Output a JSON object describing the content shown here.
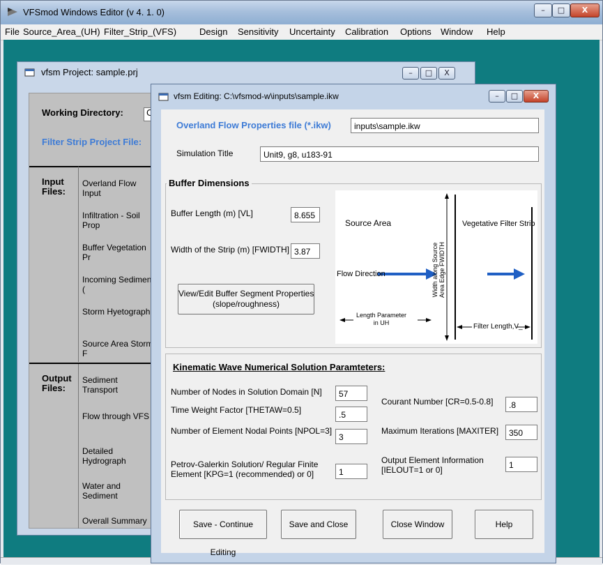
{
  "app": {
    "title": "VFSmod Windows Editor (v 4. 1. 0)",
    "window_controls": {
      "minimize": "–",
      "maximize": "□",
      "close": "X"
    }
  },
  "menu": [
    "File",
    "Source_Area_(UH)",
    "Filter_Strip_(VFS)",
    "Design",
    "Sensitivity",
    "Uncertainty",
    "Calibration",
    "Options",
    "Window",
    "Help"
  ],
  "project_window": {
    "title": "vfsm Project: sample.prj",
    "working_directory_label": "Working Directory:",
    "working_directory_value": "C",
    "filter_strip_label": "Filter Strip Project File:",
    "input_files_label": "Input\nFiles:",
    "input_items": [
      "Overland Flow Input",
      "Infiltration - Soil Prop",
      "Buffer Vegetation Pr",
      "Incoming Sediment (",
      "Storm Hyetograph",
      "Source Area Storm F"
    ],
    "output_files_label": "Output\nFiles:",
    "output_items": [
      "Sediment Transport",
      "Flow through VFS",
      "Detailed Hydrograph",
      "Water and Sediment",
      "Overall Summary"
    ]
  },
  "edit_window": {
    "title": "vfsm Editing: C:\\vfsmod-w\\inputs\\sample.ikw",
    "overland_label": "Overland Flow Properties file (*.ikw)",
    "overland_value": "inputs\\sample.ikw",
    "sim_title_label": "Simulation Title",
    "sim_title_value": "Unit9, g8, u183-91",
    "buffer_frame_title": "Buffer Dimensions",
    "buffer_length_label": "Buffer Length (m) [VL]",
    "buffer_length_value": "8.655",
    "width_label": "Width of the Strip (m) [FWIDTH]",
    "width_value": "3.87",
    "segment_button": "View/Edit Buffer Segment Properties\n(slope/roughness)",
    "diagram": {
      "source_area": "Source Area",
      "vfs": "Vegetative Filter Strip",
      "flow_direction": "Flow Direction",
      "length_param": "Length Parameter\nin UH",
      "width_along": "Width along Source\nArea Edge FWIDTH",
      "filter_length": "Filter Length,V_"
    },
    "kw_frame_title": "Kinematic Wave Numerical Solution Paramteters:",
    "params": {
      "nodes_label": "Number of Nodes in Solution Domain [N]",
      "nodes_value": "57",
      "theta_label": "Time Weight Factor [THETAW=0.5]",
      "theta_value": ".5",
      "npol_label": "Number of Element Nodal Points [NPOL=3]",
      "npol_value": "3",
      "kpg_label": "Petrov-Galerkin Solution/ Regular Finite\nElement [KPG=1 (recommended) or 0]",
      "kpg_value": "1",
      "courant_label": "Courant Number [CR=0.5-0.8]",
      "courant_value": ".8",
      "maxiter_label": "Maximum Iterations [MAXITER]",
      "maxiter_value": "350",
      "ielout_label": "Output Element Information\n[IELOUT=1 or 0]",
      "ielout_value": "1"
    },
    "buttons": {
      "save_continue": "Save - Continue Editing",
      "save_close": "Save and Close",
      "close_window": "Close Window",
      "help": "Help"
    }
  },
  "colors": {
    "mdi_background": "#0f7c80",
    "label_blue": "#3d7bd6",
    "arrow_blue": "#1f5fc4"
  }
}
